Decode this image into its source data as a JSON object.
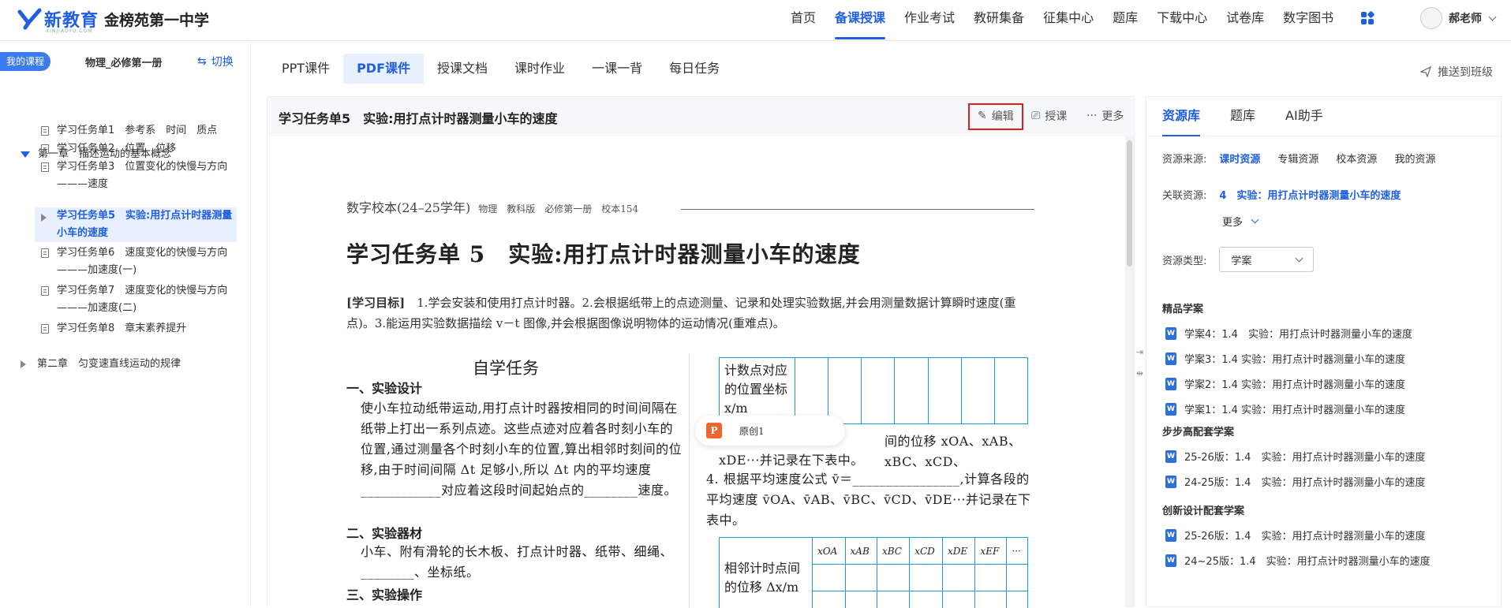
{
  "header": {
    "logo_text": "新教育",
    "logo_sub": "XINJIAOYU.COM",
    "school": "金榜苑第一中学",
    "nav": [
      "首页",
      "备课授课",
      "作业考试",
      "教研集备",
      "征集中心",
      "题库",
      "下载中心",
      "试卷库",
      "数字图书"
    ],
    "nav_active": "备课授课",
    "user_name": "郝老师"
  },
  "sidebar": {
    "tag": "我的课程",
    "course": "物理_必修第一册",
    "switch": "切换",
    "chapter1": "第一章　描述运动的基本概念",
    "tasks": [
      {
        "label": "学习任务单1　参考系　时间　质点"
      },
      {
        "label": "学习任务单2　位置　位移"
      },
      {
        "label": "学习任务单3　位置变化的快慢与方向———速度"
      },
      {
        "label": "学习任务单5　实验:用打点计时器测量小车的速度"
      },
      {
        "label": "学习任务单6　速度变化的快慢与方向———加速度(一)"
      },
      {
        "label": "学习任务单7　速度变化的快慢与方向———加速度(二)"
      },
      {
        "label": "学习任务单8　章末素养提升"
      }
    ],
    "active_more": "···",
    "chapter2": "第二章　匀变速直线运动的规律"
  },
  "tabs": [
    "PPT课件",
    "PDF课件",
    "授课文档",
    "课时作业",
    "一课一背",
    "每日任务"
  ],
  "push": "推送到班级",
  "viewer": {
    "title": "学习任务单5　实验:用打点计时器测量小车的速度",
    "edit": "编辑",
    "teach": "授课",
    "more": "更多",
    "float_label": "原创1"
  },
  "doc": {
    "header": "数字校本(24–25学年)",
    "header_small": "物理　教科版　必修第一册　校本154",
    "title": "学习任务单 5　实验:用打点计时器测量小车的速度",
    "goal_tag": "[学习目标]",
    "goal_text": "　1.学会安装和使用打点计时器。2.会根据纸带上的点迹测量、记录和处理实验数据,并会用测量数据计算瞬时速度(重点)。3.能运用实验数据描绘 v－t 图像,并会根据图像说明物体的运动情况(重难点)。",
    "self_study": "自学任务",
    "sec1": "一、实验设计",
    "para1": "使小车拉动纸带运动,用打点计时器按相同的时间间隔在纸带上打出一系列点迹。这些点迹对应着各时刻小车的位置,通过测量各个时刻小车的位置,算出相邻时刻间的位移,由于时间间隔 Δt 足够小,所以 Δt 内的平均速度____________对应着这段时间起始点的________速度。",
    "sec2": "二、实验器材",
    "para2": "小车、附有滑轮的长木板、打点计时器、纸带、细绳、________、坐标纸。",
    "sec3": "三、实验操作",
    "table1_head": "计数点对应的位置坐标 x/m",
    "r_text1": "间的位移 xOA、xAB、xBC、xCD、",
    "r_text2": "xDE···并记录在下表中。",
    "r_text3": "4. 根据平均速度公式 v̄＝________________,计算各段的平均速度 v̄OA、v̄AB、v̄BC、v̄CD、v̄DE···并记录在下表中。",
    "table2_head": "相邻计时点间的位移 Δx/m",
    "table2_cols": [
      "xOA",
      "xAB",
      "xBC",
      "xCD",
      "xDE",
      "xEF",
      "···"
    ]
  },
  "right": {
    "tabs": [
      "资源库",
      "题库",
      "AI助手"
    ],
    "source_label": "资源来源:",
    "sources": [
      "课时资源",
      "专辑资源",
      "校本资源",
      "我的资源"
    ],
    "related_label": "关联资源:",
    "related_value": "4　实验：用打点计时器测量小车的速度",
    "more": "更多",
    "type_label": "资源类型:",
    "type_value": "学案",
    "groups": [
      {
        "title": "精品学案",
        "items": [
          "学案4：1.4　实验：用打点计时器测量小车的速度",
          "学案3：1.4 实验：用打点计时器测量小车的速度",
          "学案2：1.4 实验：用打点计时器测量小车的速度",
          "学案1：1.4 实验：用打点计时器测量小车的速度"
        ]
      },
      {
        "title": "步步高配套学案",
        "items": [
          "25-26版：1.4　实验：用打点计时器测量小车的速度",
          "24-25版：1.4　实验：用打点计时器测量小车的速度"
        ]
      },
      {
        "title": "创新设计配套学案",
        "items": [
          "25-26版：1.4　实验：用打点计时器测量小车的速度",
          "24~25版：1.4　实验：用打点计时器测量小车的速度"
        ]
      }
    ]
  }
}
